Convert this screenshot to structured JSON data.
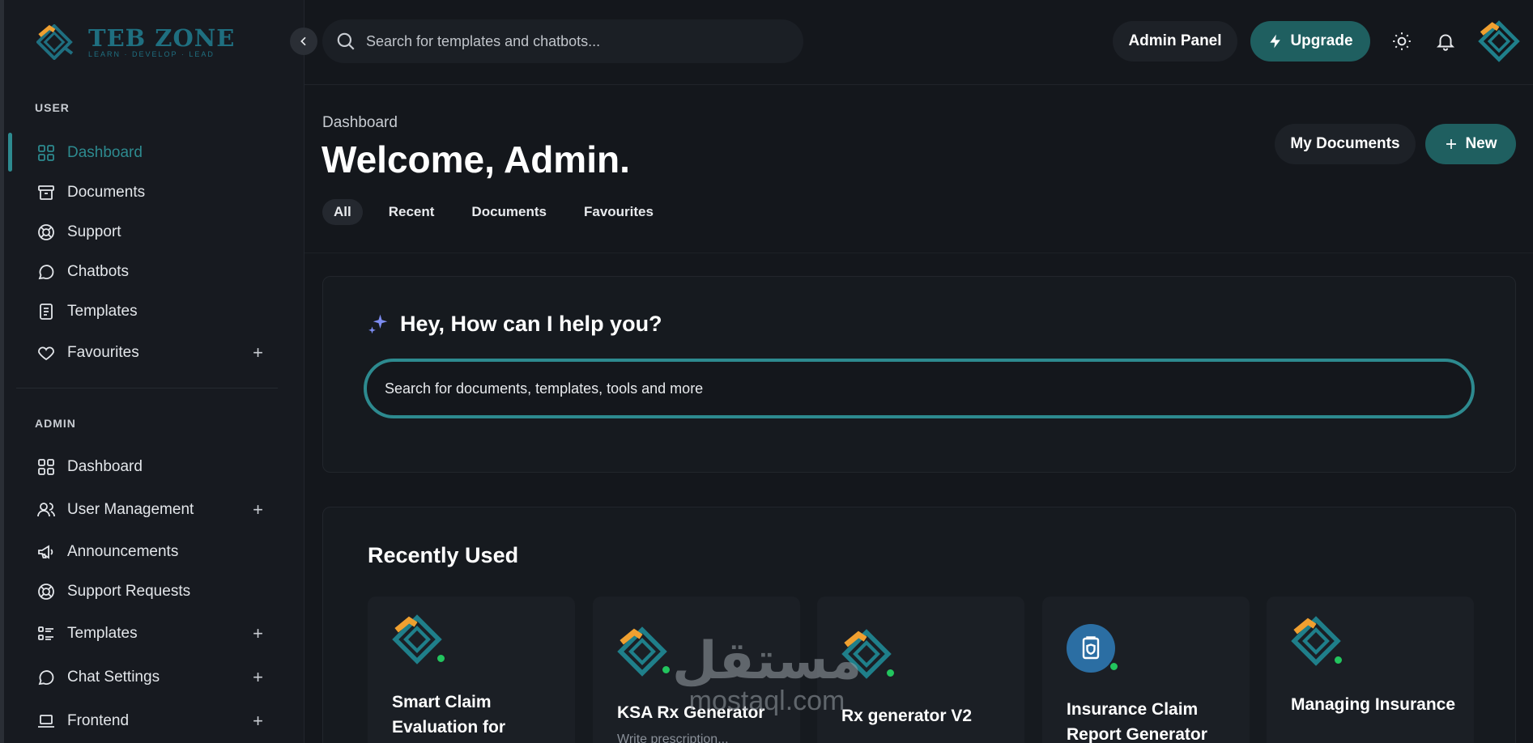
{
  "brand": {
    "name": "TEB ZONE",
    "tagline": "LEARN · DEVELOP · LEAD",
    "accent": "#2d8a8f",
    "orange": "#f0a030"
  },
  "sidebar": {
    "user_section": "USER",
    "user_items": [
      {
        "label": "Dashboard",
        "icon": "grid-icon"
      },
      {
        "label": "Documents",
        "icon": "archive-icon"
      },
      {
        "label": "Support",
        "icon": "lifebuoy-icon"
      },
      {
        "label": "Chatbots",
        "icon": "chat-bubble-icon"
      },
      {
        "label": "Templates",
        "icon": "document-icon"
      },
      {
        "label": "Favourites",
        "icon": "heart-icon",
        "plus": "+"
      }
    ],
    "admin_section": "ADMIN",
    "admin_items": [
      {
        "label": "Dashboard",
        "icon": "grid-icon"
      },
      {
        "label": "User Management",
        "icon": "users-icon",
        "plus": "+"
      },
      {
        "label": "Announcements",
        "icon": "megaphone-icon"
      },
      {
        "label": "Support Requests",
        "icon": "lifebuoy-icon"
      },
      {
        "label": "Templates",
        "icon": "list-icon",
        "plus": "+"
      },
      {
        "label": "Chat Settings",
        "icon": "chat-bubble-icon",
        "plus": "+"
      },
      {
        "label": "Frontend",
        "icon": "laptop-icon",
        "plus": "+"
      }
    ]
  },
  "topbar": {
    "search_placeholder": "Search for templates and chatbots...",
    "admin_panel": "Admin Panel",
    "upgrade": "Upgrade"
  },
  "header": {
    "breadcrumb": "Dashboard",
    "title": "Welcome, Admin.",
    "tabs": [
      "All",
      "Recent",
      "Documents",
      "Favourites"
    ],
    "my_documents": "My Documents",
    "new": "New"
  },
  "help": {
    "title": "Hey, How can I help you?",
    "placeholder": "Search for documents, templates, tools and more"
  },
  "recent": {
    "title": "Recently Used",
    "items": [
      {
        "name": "Smart Claim Evaluation for",
        "sub": ""
      },
      {
        "name": "KSA Rx Generator",
        "sub": "Write prescription..."
      },
      {
        "name": "Rx generator V2",
        "sub": ""
      },
      {
        "name": "Insurance Claim Report Generator",
        "sub": ""
      },
      {
        "name": "Managing Insurance",
        "sub": ""
      }
    ]
  },
  "watermark": {
    "arabic": "مستقل",
    "latin": "mostaql.com"
  }
}
